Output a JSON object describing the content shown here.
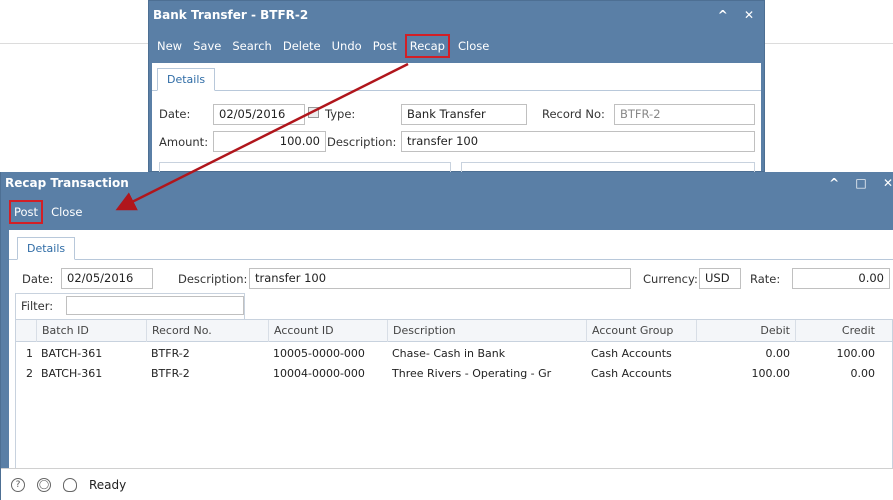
{
  "bank_transfer": {
    "title": "Bank Transfer - BTFR-2",
    "toolbar": [
      "New",
      "Save",
      "Search",
      "Delete",
      "Undo",
      "Post",
      "Recap",
      "Close"
    ],
    "tab": "Details",
    "date_label": "Date:",
    "date_value": "02/05/2016",
    "type_label": "Type:",
    "type_value": "Bank Transfer",
    "record_label": "Record No:",
    "record_value": "BTFR-2",
    "amount_label": "Amount:",
    "amount_value": "100.00",
    "desc_label": "Description:",
    "desc_value": "transfer 100"
  },
  "recap": {
    "title": "Recap Transaction",
    "post_label": "Post",
    "close_label": "Close",
    "tab": "Details",
    "date_label": "Date:",
    "date_value": "02/05/2016",
    "desc_label": "Description:",
    "desc_value": "transfer 100",
    "currency_label": "Currency:",
    "currency_value": "USD",
    "rate_label": "Rate:",
    "rate_value": "0.00",
    "filter_label": "Filter:",
    "filter_value": "",
    "columns": [
      "Batch ID",
      "Record No.",
      "Account ID",
      "Description",
      "Account Group",
      "Debit",
      "Credit"
    ],
    "rows": [
      {
        "num": "1",
        "batch": "BATCH-361",
        "record": "BTFR-2",
        "account": "10005-0000-000",
        "desc": "Chase- Cash in Bank",
        "group": "Cash Accounts",
        "debit": "0.00",
        "credit": "100.00"
      },
      {
        "num": "2",
        "batch": "BATCH-361",
        "record": "BTFR-2",
        "account": "10004-0000-000",
        "desc": "Three Rivers - Operating - Gr",
        "group": "Cash Accounts",
        "debit": "100.00",
        "credit": "0.00"
      }
    ],
    "status": "Ready"
  },
  "colors": {
    "titlebar": "#5a7fa6",
    "highlight": "#d21f26",
    "tab_text": "#2f6ca6"
  }
}
